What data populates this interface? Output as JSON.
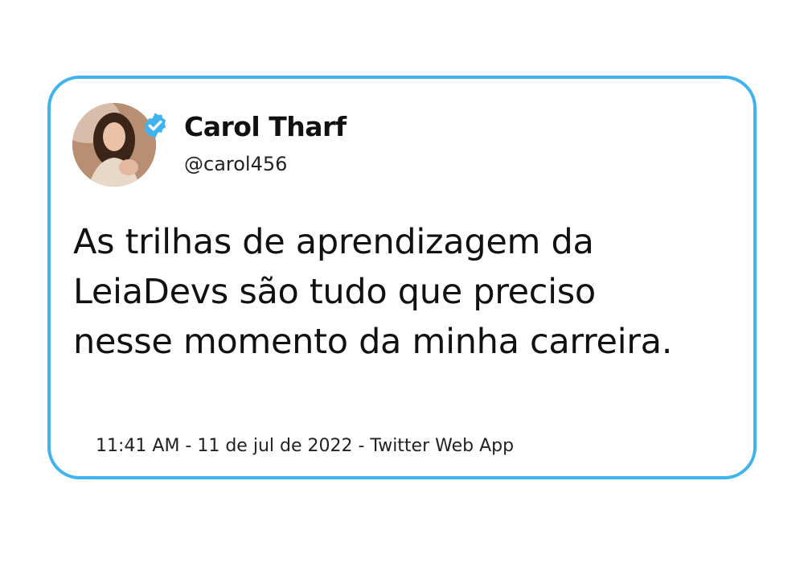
{
  "tweet": {
    "author_name": "Carol Tharf",
    "handle": "@carol456",
    "text": "As trilhas de aprendizagem da LeiaDevs são tudo que preciso nesse momento da minha carreira.",
    "meta": "11:41 AM - 11 de jul de 2022 - Twitter Web App",
    "verified": true
  },
  "colors": {
    "border": "#3fb2f0",
    "verified_badge": "#3fb2f0",
    "text": "#111111"
  },
  "icons": {
    "verified": "verified-badge-icon",
    "avatar": "profile-photo"
  }
}
